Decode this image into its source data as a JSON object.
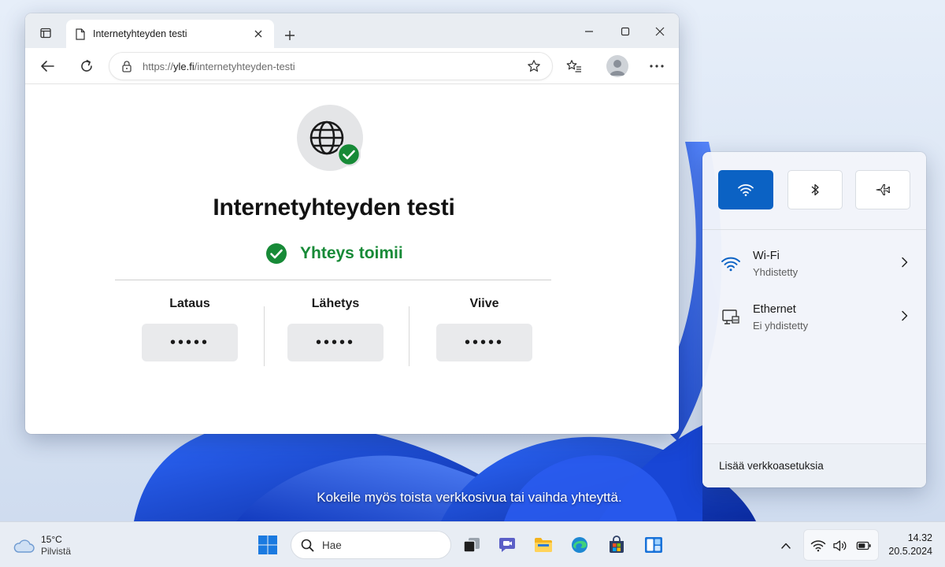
{
  "browser": {
    "tab_title": "Internetyhteyden testi",
    "url_prefix": "https://",
    "url_domain": "yle.fi",
    "url_path": "/internetyhteyden-testi"
  },
  "page": {
    "title": "Internetyhteyden testi",
    "status": "Yhteys toimii",
    "metrics": [
      {
        "label": "Lataus",
        "value": "•••••"
      },
      {
        "label": "Lähetys",
        "value": "•••••"
      },
      {
        "label": "Viive",
        "value": "•••••"
      }
    ]
  },
  "flyout": {
    "quick_toggles": [
      {
        "icon": "wifi-icon",
        "active": true
      },
      {
        "icon": "bluetooth-icon",
        "active": false
      },
      {
        "icon": "airplane-icon",
        "active": false
      }
    ],
    "networks": [
      {
        "name": "Wi-Fi",
        "status": "Yhdistetty",
        "icon": "wifi-icon"
      },
      {
        "name": "Ethernet",
        "status": "Ei yhdistetty",
        "icon": "ethernet-icon"
      }
    ],
    "more_settings": "Lisää verkkoasetuksia"
  },
  "subtitle": "Kokeile myös toista verkkosivua tai vaihda yhteyttä.",
  "taskbar": {
    "weather_temp": "15°C",
    "weather_condition": "Pilvistä",
    "search_label": "Hae",
    "time": "14.32",
    "date": "20.5.2024"
  },
  "colors": {
    "accent": "#0b62c4",
    "success": "#178a37",
    "window_bg": "#ffffff"
  }
}
